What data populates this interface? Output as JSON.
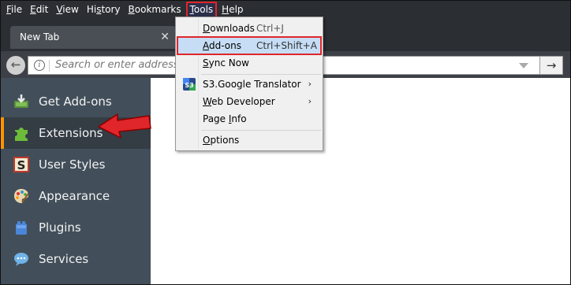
{
  "menubar": {
    "items": [
      {
        "key": "F",
        "rest": "ile"
      },
      {
        "key": "E",
        "rest": "dit"
      },
      {
        "key": "V",
        "rest": "iew"
      },
      {
        "pre": "Hi",
        "key": "s",
        "rest": "tory"
      },
      {
        "key": "B",
        "rest": "ookmarks"
      },
      {
        "key": "T",
        "rest": "ools"
      },
      {
        "key": "H",
        "rest": "elp"
      }
    ]
  },
  "tab": {
    "title": "New Tab",
    "close": "✕"
  },
  "navbar": {
    "back": "←",
    "url_placeholder": "Search or enter address",
    "go": "→"
  },
  "sidebar": {
    "categories": [
      {
        "label": "Get Add-ons",
        "icon": "get-addons-icon"
      },
      {
        "label": "Extensions",
        "icon": "puzzle-piece-icon",
        "selected": true
      },
      {
        "label": "User Styles",
        "icon": "stylish-icon"
      },
      {
        "label": "Appearance",
        "icon": "palette-icon"
      },
      {
        "label": "Plugins",
        "icon": "plugin-brick-icon"
      },
      {
        "label": "Services",
        "icon": "speech-bubble-icon"
      }
    ]
  },
  "tools_menu": {
    "downloads": {
      "key": "D",
      "rest": "ownloads",
      "accel": "Ctrl+J"
    },
    "addons": {
      "key": "A",
      "rest": "dd-ons",
      "accel": "Ctrl+Shift+A"
    },
    "sync": {
      "key": "S",
      "rest": "ync Now"
    },
    "translator": {
      "label": "S3.Google Translator",
      "icon_text": "S3",
      "submenu": "›"
    },
    "webdev": {
      "key": "W",
      "rest": "eb Developer",
      "submenu": "›"
    },
    "pageinfo": {
      "pre": "Page ",
      "key": "I",
      "rest": "nfo"
    },
    "options": {
      "key": "O",
      "rest": "ptions"
    }
  },
  "colors": {
    "highlight_outline": "#e0262a",
    "selected_accent": "#ff9500",
    "sidebar_bg": "#424f5a"
  }
}
